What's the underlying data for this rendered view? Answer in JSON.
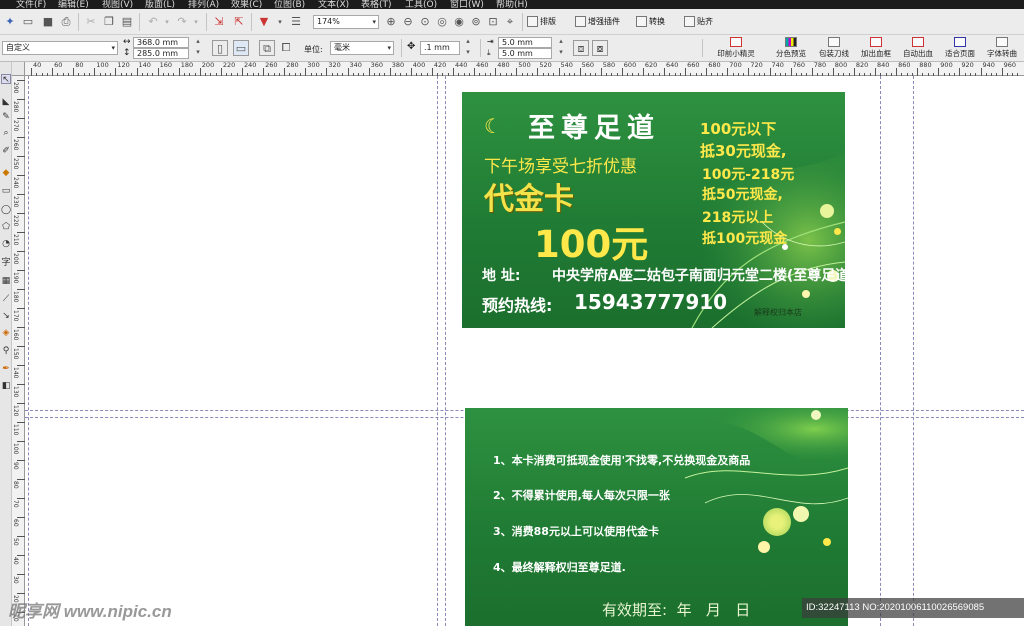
{
  "menu": [
    "文件(F)",
    "编辑(E)",
    "视图(V)",
    "版面(L)",
    "排列(A)",
    "效果(C)",
    "位图(B)",
    "文本(X)",
    "表格(T)",
    "工具(O)",
    "窗口(W)",
    "帮助(H)"
  ],
  "toolbar": {
    "zoom": "174%",
    "plugins": [
      "排版",
      "增强插件",
      "转换",
      "贴齐"
    ]
  },
  "property_bar": {
    "page_size": "自定义",
    "width": "368.0 mm",
    "height": "285.0 mm",
    "unit_label": "单位:",
    "unit": "毫米",
    "nudge": ".1 mm",
    "dup_x": "5.0 mm",
    "dup_y": "5.0 mm",
    "print_tools": [
      "印前小精灵",
      "分色预览",
      "包装刀线",
      "加出血框",
      "自动出血",
      "适合页面",
      "字体转曲"
    ]
  },
  "ruler": {
    "h": [
      "40",
      "60",
      "80",
      "100",
      "120",
      "140",
      "160",
      "180",
      "200",
      "220",
      "240",
      "260",
      "280",
      "300",
      "320",
      "340",
      "360",
      "380",
      "400",
      "420",
      "440",
      "460",
      "480",
      "500",
      "520",
      "540",
      "560",
      "580",
      "600",
      "620",
      "640",
      "660",
      "680",
      "700",
      "720",
      "740",
      "760",
      "780",
      "800",
      "820",
      "840",
      "860",
      "880",
      "900",
      "920",
      "940",
      "960",
      "980",
      "1000"
    ],
    "v": [
      "290",
      "280",
      "270",
      "260",
      "250",
      "240",
      "230",
      "220",
      "210",
      "200",
      "190",
      "180",
      "170",
      "160",
      "150",
      "140",
      "130",
      "120",
      "110",
      "100",
      "90",
      "80",
      "70",
      "60",
      "50",
      "40",
      "30",
      "20",
      "10"
    ]
  },
  "card_front": {
    "title": "至尊足道",
    "subtitle": "下午场享受七折优惠",
    "voucher": "代金卡",
    "amount": "100元",
    "offers": [
      "100元以下",
      "抵30元现金,",
      "100元-218元",
      "抵50元现金,",
      "218元以上",
      "抵100元现金"
    ],
    "address_label": "地  址:",
    "address": "中央学府A座二姑包子南面归元堂二楼(至尊足道)",
    "hotline_label": "预约热线:",
    "hotline": "15943777910",
    "note": "解释权归本店"
  },
  "card_back": {
    "rules": [
      "1、本卡消费可抵现金使用'不找零,不兑换现金及商品",
      "2、不得累计使用,每人每次只限一张",
      "3、消费88元以上可以使用代金卡",
      "4、最终解释权归至尊足道."
    ],
    "validity": "有效期至:  年   月   日"
  },
  "watermark": "昵享网 www.nipic.cn",
  "image_info": "ID:32247113 NO:20201006110026569085"
}
